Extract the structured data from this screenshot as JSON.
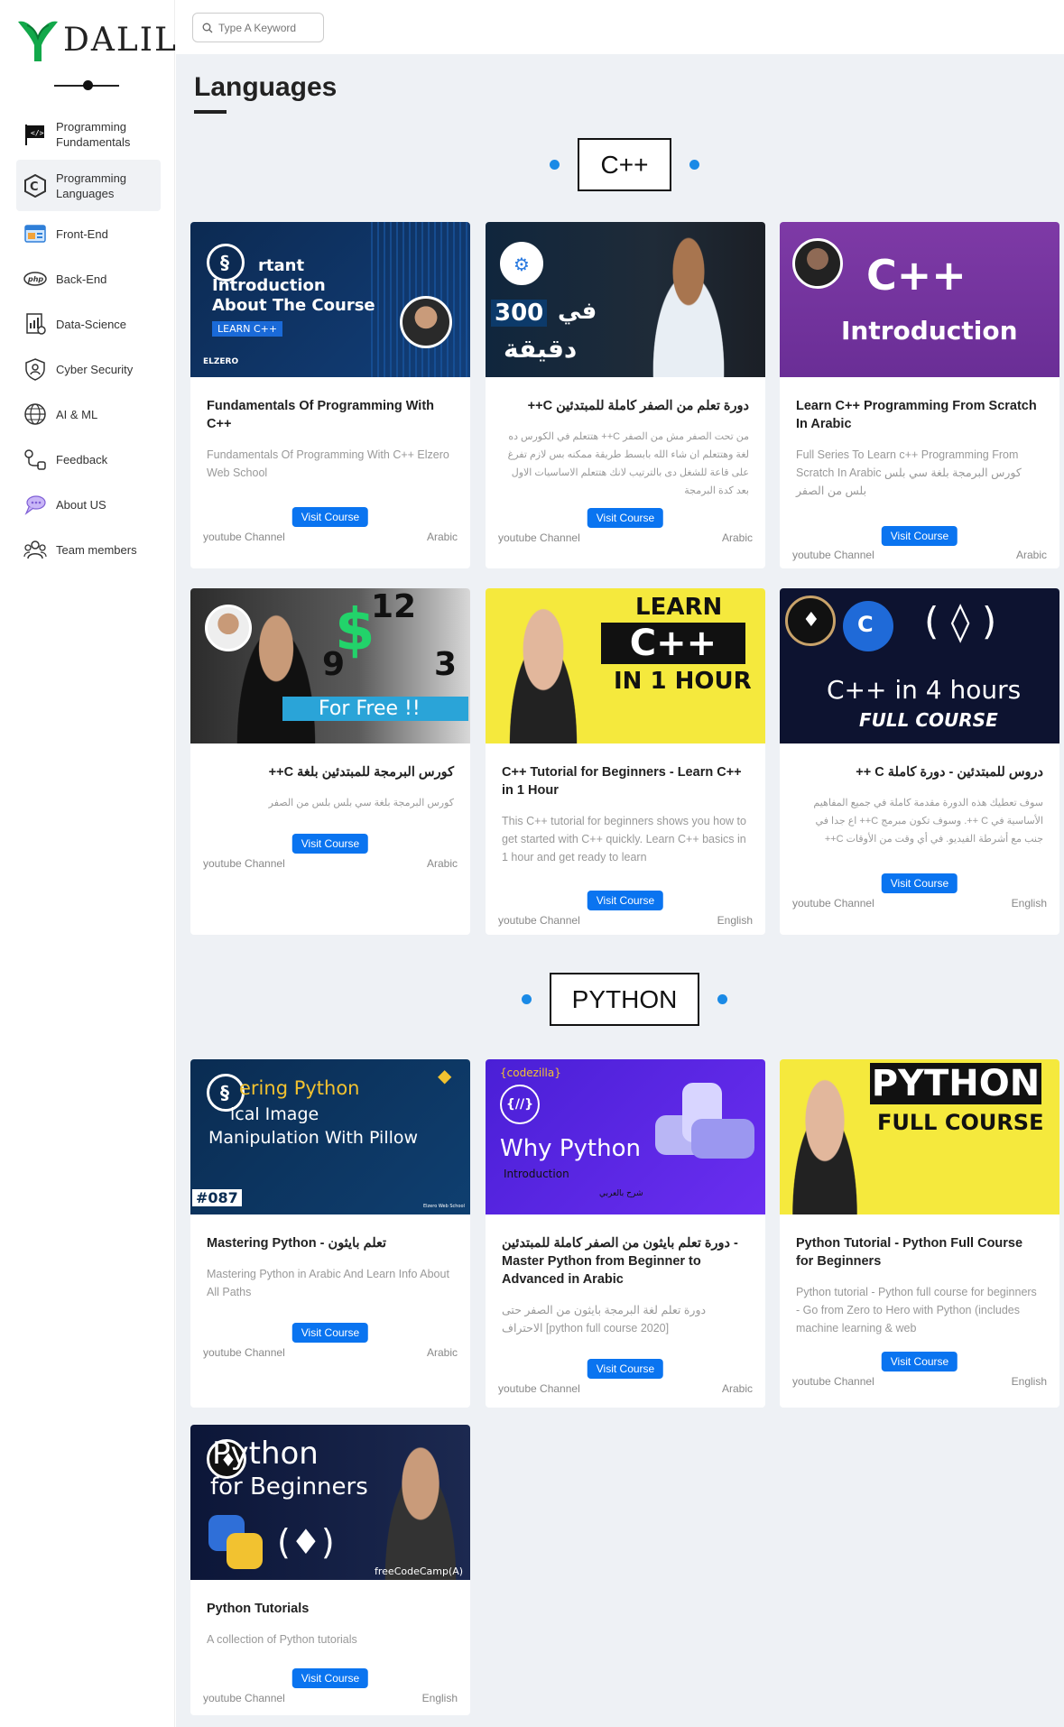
{
  "brand": {
    "name": "DALIL"
  },
  "search": {
    "placeholder": "Type A Keyword"
  },
  "sidebar": {
    "items": [
      {
        "label": "Programming Fundamentals",
        "icon": "code-flag-icon"
      },
      {
        "label": "Programming Languages",
        "icon": "c-language-icon"
      },
      {
        "label": "Front-End",
        "icon": "browser-window-icon"
      },
      {
        "label": "Back-End",
        "icon": "php-icon"
      },
      {
        "label": "Data-Science",
        "icon": "data-report-icon"
      },
      {
        "label": "Cyber Security",
        "icon": "shield-person-icon"
      },
      {
        "label": "AI & ML",
        "icon": "brain-globe-icon"
      },
      {
        "label": "Feedback",
        "icon": "feedback-link-icon"
      },
      {
        "label": "About US",
        "icon": "chat-bubble-icon"
      },
      {
        "label": "Team members",
        "icon": "team-icon"
      }
    ]
  },
  "page": {
    "title": "Languages"
  },
  "sections": [
    {
      "heading": "C++",
      "cards": [
        {
          "thumb_text": [
            "rtant",
            "Introduction",
            "About The Course"
          ],
          "thumb_badge": "LEARN C++",
          "thumb_brand": "ELZERO",
          "title": "Fundamentals Of Programming With C++",
          "desc": "Fundamentals Of Programming With C++ Elzero Web School",
          "button": "Visit Course",
          "channel": "youtube Channel",
          "lang": "Arabic"
        },
        {
          "thumb_text": [
            "300",
            "في",
            "دقيقة"
          ],
          "title": "دورة تعلم من الصفر كاملة للمبتدئين C++",
          "desc": "من تحت الصفر مش من الصفر C++ هتتعلم في الكورس ده لغة وهتتعلم ان شاء الله بابسط طريقة ممكنه بس لازم تفرغ على قاعة للشغل دى بالترتيب لانك هتتعلم الاساسيات الاول بعد كدة البرمجة",
          "button": "Visit Course",
          "channel": "youtube Channel",
          "lang": "Arabic"
        },
        {
          "thumb_text": [
            "C++",
            "Introduction"
          ],
          "title": "Learn C++ Programming From Scratch In Arabic",
          "desc": "Full Series To Learn c++ Programming From Scratch In Arabic كورس البرمجة بلغة سي بلس بلس من الصفر",
          "button": "Visit Course",
          "channel": "youtube Channel",
          "lang": "Arabic"
        },
        {
          "thumb_text": [
            "12",
            "9",
            "3",
            "For Free !!"
          ],
          "title": "كورس البرمجة للمبتدئين بلغة C++",
          "desc": "كورس البرمجة بلغة سي بلس بلس من الصفر",
          "button": "Visit Course",
          "channel": "youtube Channel",
          "lang": "Arabic"
        },
        {
          "thumb_text": [
            "LEARN",
            "C++",
            "IN 1 HOUR"
          ],
          "title": "C++ Tutorial for Beginners - Learn C++ in 1 Hour",
          "desc": "This C++ tutorial for beginners shows you how to get started with C++ quickly. Learn C++ basics in 1 hour and get ready to learn",
          "button": "Visit Course",
          "channel": "youtube Channel",
          "lang": "English"
        },
        {
          "thumb_text": [
            "( ◊ )",
            "C++ in 4 hours",
            "FULL COURSE"
          ],
          "title": "دروس للمبتدئين - دورة كاملة C ++",
          "desc": "سوف تعطيك هذه الدورة مقدمة كاملة في جميع المفاهيم الأساسية في C ++. وسوف تكون مبرمج C++ اع جدا في جنب مع أشرطة الفيديو. في أي وقت من الأوقات C++",
          "button": "Visit Course",
          "channel": "youtube Channel",
          "lang": "English"
        }
      ]
    },
    {
      "heading": "PYTHON",
      "cards": [
        {
          "thumb_text": [
            "ering Python",
            "ical Image",
            "Manipulation With Pillow",
            "#087",
            "Elzero Web School"
          ],
          "title": "Mastering Python - تعلم بايثون",
          "desc": "Mastering Python in Arabic And Learn Info About All Paths",
          "button": "Visit Course",
          "channel": "youtube Channel",
          "lang": "Arabic"
        },
        {
          "thumb_text": [
            "{codezilla}",
            "{//}",
            "Why Python",
            "Introduction",
            "شرح بالعربي"
          ],
          "title": "دورة تعلم بايثون من الصفر كاملة للمبتدئين - Master Python from Beginner to Advanced in Arabic",
          "desc": "دورة تعلم لغة البرمجة بايثون من الصفر حتى الاحتراف [python full course 2020]",
          "button": "Visit Course",
          "channel": "youtube Channel",
          "lang": "Arabic"
        },
        {
          "thumb_text": [
            "PYTHON",
            "FULL COURSE"
          ],
          "title": "Python Tutorial - Python Full Course for Beginners",
          "desc": "Python tutorial - Python full course for beginners - Go from Zero to Hero with Python (includes machine learning & web",
          "button": "Visit Course",
          "channel": "youtube Channel",
          "lang": "English"
        },
        {
          "thumb_text": [
            "Python",
            "for Beginners",
            "freeCodeCamp(A)"
          ],
          "title": "Python Tutorials",
          "desc": "A collection of Python tutorials",
          "button": "Visit Course",
          "channel": "youtube Channel",
          "lang": "English"
        }
      ]
    }
  ],
  "colors": {
    "accent": "#0a74f0",
    "dot": "#1a8ae6",
    "background": "#eef1f5"
  }
}
